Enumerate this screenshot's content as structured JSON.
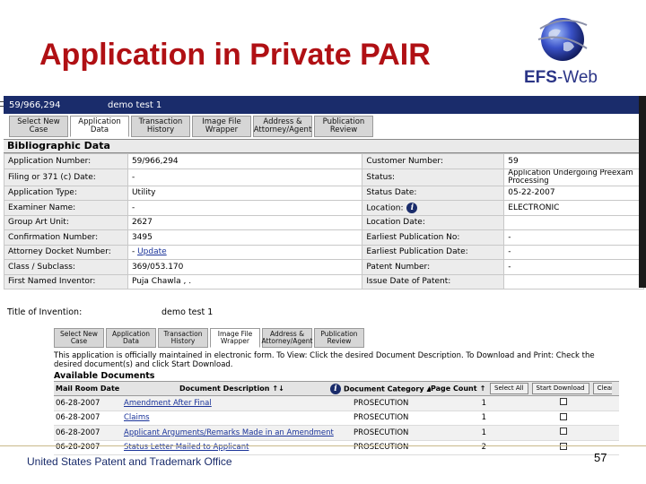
{
  "slide": {
    "title": "Application in Private PAIR",
    "logo_text_a": "EFS",
    "logo_text_b": "-Web",
    "footer": "United States Patent and Trademark Office",
    "page_number": "57"
  },
  "shot1": {
    "header": {
      "app_number": "59/966,294",
      "title": "demo test 1"
    },
    "tabs": [
      {
        "label": "Select New Case"
      },
      {
        "label": "Application Data"
      },
      {
        "label": "Transaction History"
      },
      {
        "label": "Image File Wrapper"
      },
      {
        "label": "Address & Attorney/Agent"
      },
      {
        "label": "Publication Review"
      }
    ],
    "section_title": "Bibliographic Data",
    "rows": [
      {
        "l1": "Application Number:",
        "v1": "59/966,294",
        "l2": "Customer Number:",
        "v2": "59"
      },
      {
        "l1": "Filing or 371 (c) Date:",
        "v1": "-",
        "l2": "Status:",
        "v2": "Application Undergoing Preexam Processing"
      },
      {
        "l1": "Application Type:",
        "v1": "Utility",
        "l2": "Status Date:",
        "v2": "05-22-2007"
      },
      {
        "l1": "Examiner Name:",
        "v1": "-",
        "l2": "Location:",
        "v2": "ELECTRONIC"
      },
      {
        "l1": "Group Art Unit:",
        "v1": "2627",
        "l2": "Location Date:",
        "v2": ""
      },
      {
        "l1": "Confirmation Number:",
        "v1": "3495",
        "l2": "Earliest Publication No:",
        "v2": "-"
      },
      {
        "l1": "Attorney Docket Number:",
        "v1": "- ",
        "v1_link": "Update",
        "l2": "Earliest Publication Date:",
        "v2": "-"
      },
      {
        "l1": "Class / Subclass:",
        "v1": "369/053.170",
        "l2": "Patent Number:",
        "v2": "-"
      },
      {
        "l1": "First Named Inventor:",
        "v1": "Puja Chawla , .",
        "l2": "Issue Date of Patent:",
        "v2": ""
      }
    ],
    "title_label": "Title of Invention:",
    "title_value": "demo test 1"
  },
  "shot2": {
    "tabs": [
      {
        "label": "Select New Case"
      },
      {
        "label": "Application Data"
      },
      {
        "label": "Transaction History"
      },
      {
        "label": "Image File Wrapper"
      },
      {
        "label": "Address & Attorney/Agent"
      },
      {
        "label": "Publication Review"
      }
    ],
    "notice": "This application is officially maintained in electronic form. To View: Click the desired Document Description. To Download and Print: Check the desired document(s) and click Start Download.",
    "available_title": "Available Documents",
    "columns": {
      "mail_room_date": "Mail Room Date",
      "description": "Document Description",
      "category": "Document Category",
      "page_count": "Page Count",
      "select_all": "Select All",
      "start_download": "Start Download",
      "clear_all": "Clear All"
    },
    "documents": [
      {
        "date": "06-28-2007",
        "desc": "Amendment After Final",
        "category": "PROSECUTION",
        "pages": "1"
      },
      {
        "date": "06-28-2007",
        "desc": "Claims",
        "category": "PROSECUTION",
        "pages": "1"
      },
      {
        "date": "06-28-2007",
        "desc": "Applicant Arguments/Remarks Made in an Amendment",
        "category": "PROSECUTION",
        "pages": "1"
      },
      {
        "date": "06-28-2007",
        "desc": "Status Letter Mailed to Applicant",
        "category": "PROSECUTION",
        "pages": "2"
      }
    ]
  },
  "colors": {
    "title_red": "#b01014",
    "header_navy": "#1a2c6b",
    "logo_blue": "#2a3486"
  }
}
